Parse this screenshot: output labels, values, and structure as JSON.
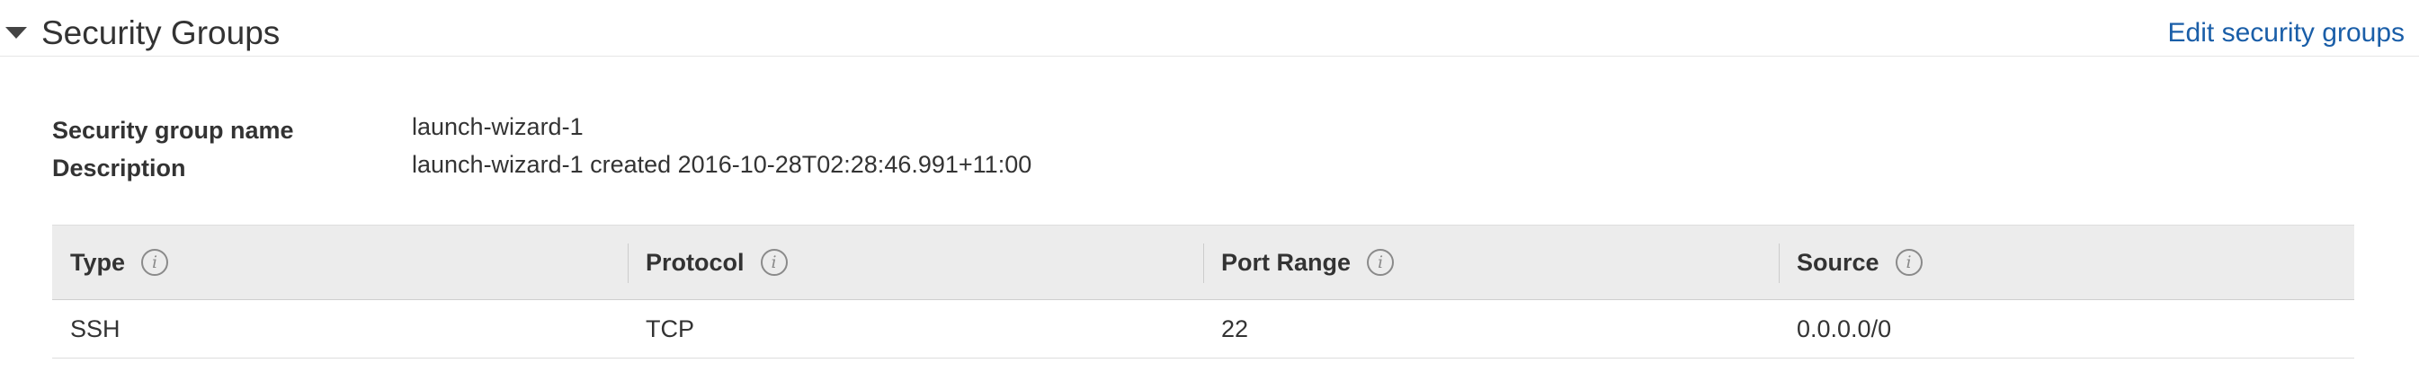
{
  "section": {
    "title": "Security Groups",
    "edit_link": "Edit security groups",
    "caret_icon": "caret-down-icon"
  },
  "details": {
    "name_label": "Security group name",
    "name_value": "launch-wizard-1",
    "description_label": "Description",
    "description_value": "launch-wizard-1 created 2016-10-28T02:28:46.991+11:00"
  },
  "table": {
    "columns": [
      {
        "label": "Type",
        "info": "i"
      },
      {
        "label": "Protocol",
        "info": "i"
      },
      {
        "label": "Port Range",
        "info": "i"
      },
      {
        "label": "Source",
        "info": "i"
      }
    ],
    "rows": [
      {
        "type": "SSH",
        "protocol": "TCP",
        "port_range": "22",
        "source": "0.0.0.0/0"
      }
    ]
  },
  "colors": {
    "link": "#1a5ea8",
    "header_bg": "#ececec",
    "text": "#333333"
  }
}
